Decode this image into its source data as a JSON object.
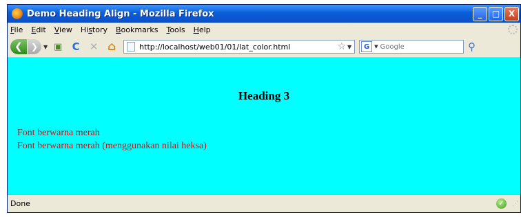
{
  "window": {
    "title": "Demo Heading Align - Mozilla Firefox",
    "controls": {
      "minimize": "_",
      "maximize": "□",
      "close": "X"
    }
  },
  "menu": [
    {
      "key": "file",
      "pre": "",
      "u": "F",
      "post": "ile"
    },
    {
      "key": "edit",
      "pre": "",
      "u": "E",
      "post": "dit"
    },
    {
      "key": "view",
      "pre": "",
      "u": "V",
      "post": "iew"
    },
    {
      "key": "history",
      "pre": "Hi",
      "u": "s",
      "post": "tory"
    },
    {
      "key": "bookmarks",
      "pre": "",
      "u": "B",
      "post": "ookmarks"
    },
    {
      "key": "tools",
      "pre": "",
      "u": "T",
      "post": "ools"
    },
    {
      "key": "help",
      "pre": "",
      "u": "H",
      "post": "elp"
    }
  ],
  "nav": {
    "back": "❮",
    "forward": "❯",
    "dropdown": "▼",
    "reload": "C",
    "stop": "✕",
    "home": "⌂",
    "star": "☆",
    "url": "http://localhost/web01/01/lat_color.html",
    "search_engine_letter": "G",
    "search_placeholder": "Google",
    "search_go": "⚲"
  },
  "content": {
    "background_color": "#00ffff",
    "heading": "Heading 3",
    "red_color": "#d01010",
    "line1": "Font berwarna merah",
    "line2": "Font berwarna merah (menggunakan nilai heksa)"
  },
  "status": {
    "text": "Done",
    "ok_icon": "✓"
  }
}
